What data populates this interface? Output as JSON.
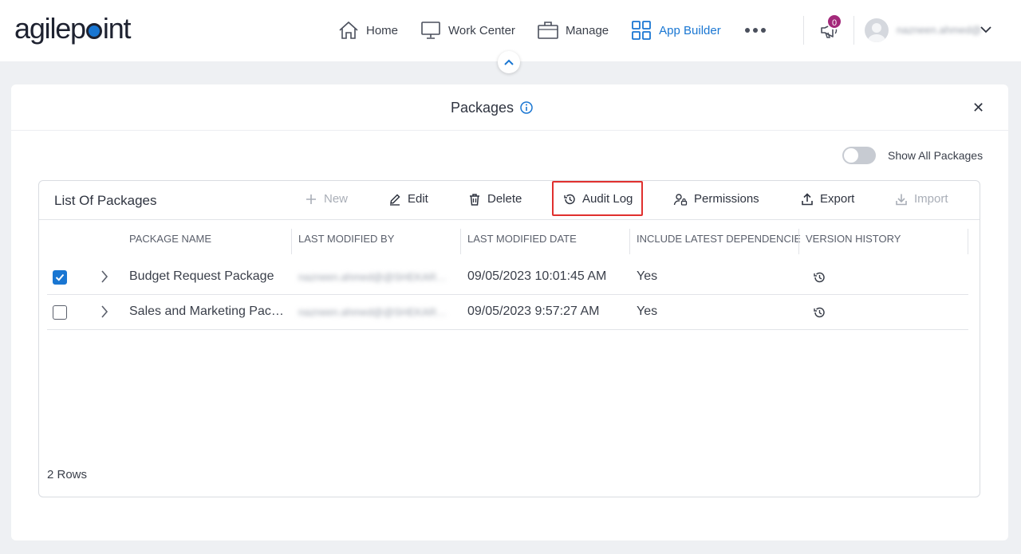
{
  "brand": {
    "logo_pre": "agilep",
    "logo_post": "int"
  },
  "nav": {
    "items": [
      {
        "label": "Home",
        "icon": "home-icon",
        "active": false
      },
      {
        "label": "Work Center",
        "icon": "monitor-icon",
        "active": false
      },
      {
        "label": "Manage",
        "icon": "briefcase-icon",
        "active": false
      },
      {
        "label": "App Builder",
        "icon": "grid-icon",
        "active": true
      }
    ],
    "notifications_count": "0",
    "username": "nazneen.ahmed@",
    "accent": "#1976d2"
  },
  "panel": {
    "title": "Packages",
    "toggle_label": "Show All Packages",
    "toggle_on": false
  },
  "card": {
    "title": "List Of Packages",
    "toolbar": {
      "new": "New",
      "edit": "Edit",
      "delete": "Delete",
      "audit_log": "Audit Log",
      "permissions": "Permissions",
      "export": "Export",
      "import": "Import"
    },
    "columns": [
      "PACKAGE NAME",
      "LAST MODIFIED BY",
      "LAST MODIFIED DATE",
      "INCLUDE LATEST DEPENDENCIES",
      "VERSION HISTORY"
    ],
    "rows": [
      {
        "checked": true,
        "name": "Budget Request Package",
        "modified_by": "nazneen.ahmed@@SHEKARSHAB...",
        "modified_date": "09/05/2023 10:01:45 AM",
        "dependencies": "Yes"
      },
      {
        "checked": false,
        "name": "Sales and Marketing Package",
        "modified_by": "nazneen.ahmed@@SHEKARSHAB...",
        "modified_date": "09/05/2023 9:57:27 AM",
        "dependencies": "Yes"
      }
    ],
    "row_count": "2 Rows"
  }
}
